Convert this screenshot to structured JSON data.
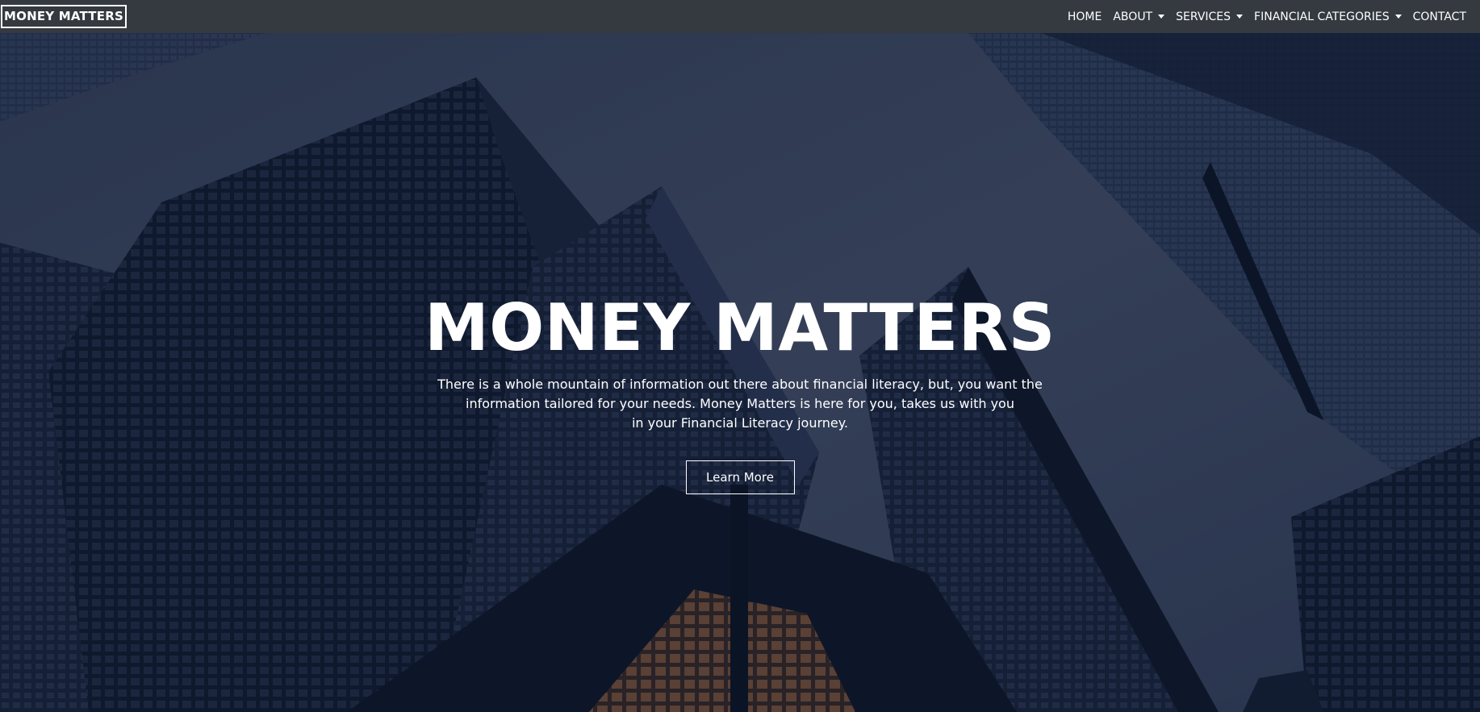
{
  "navbar": {
    "brand": "MONEY MATTERS",
    "items": [
      {
        "label": "HOME",
        "dropdown": false
      },
      {
        "label": "ABOUT",
        "dropdown": true
      },
      {
        "label": "SERVICES",
        "dropdown": true
      },
      {
        "label": "FINANCIAL CATEGORIES",
        "dropdown": true
      },
      {
        "label": "CONTACT",
        "dropdown": false
      }
    ]
  },
  "hero": {
    "title": "MONEY MATTERS",
    "text_lines": [
      "There is a whole mountain of information out there about financial literacy, but, you want the",
      "information tailored for your needs. Money Matters is here for you, takes us with you",
      "in your Financial Literacy journey."
    ],
    "button_label": "Learn More"
  },
  "colors": {
    "navbar_bg": "#343a40",
    "text": "#ffffff",
    "overlay": "#0e182e"
  }
}
